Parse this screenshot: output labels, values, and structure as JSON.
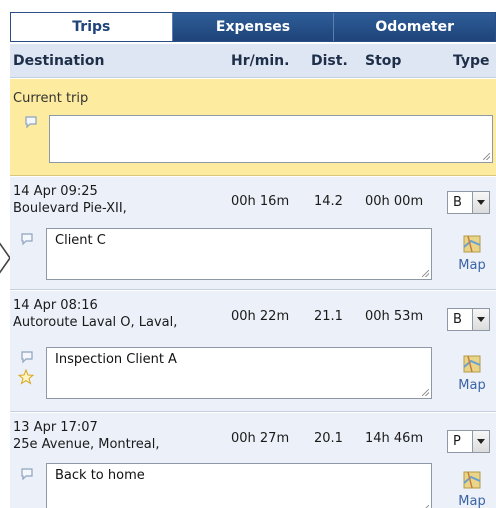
{
  "tabs": [
    {
      "label": "Trips",
      "active": true
    },
    {
      "label": "Expenses",
      "active": false
    },
    {
      "label": "Odometer",
      "active": false
    }
  ],
  "columns": {
    "destination": "Destination",
    "hr_min": "Hr/min.",
    "dist": "Dist.",
    "stop": "Stop",
    "type": "Type"
  },
  "current_trip": {
    "title": "Current trip",
    "note": ""
  },
  "trips": [
    {
      "date": "14 Apr 09:25",
      "address": "Boulevard Pie-XII,",
      "duration": "00h 16m",
      "distance": "14.2",
      "stop": "00h 00m",
      "type": "B",
      "note": "Client C",
      "map_label": "Map",
      "starred": false
    },
    {
      "date": "14 Apr 08:16",
      "address": "Autoroute Laval O, Laval,",
      "duration": "00h 22m",
      "distance": "21.1",
      "stop": "00h 53m",
      "type": "B",
      "note": "Inspection Client A",
      "map_label": "Map",
      "starred": true
    },
    {
      "date": "13 Apr 17:07",
      "address": "25e Avenue, Montreal,",
      "duration": "00h 27m",
      "distance": "20.1",
      "stop": "14h 46m",
      "type": "P",
      "note": "Back to home",
      "map_label": "Map",
      "starred": false
    }
  ],
  "icons": {
    "comment": "speech-bubble-icon",
    "star": "star-icon",
    "map": "map-icon",
    "dropdown": "chevron-down-icon"
  },
  "colors": {
    "tab_blue": "#1e4479",
    "current_trip_bg": "#fdeba0",
    "trip_bg": "#ecf1f9",
    "header_bg": "#dde6f2",
    "link_blue": "#3a63a8"
  }
}
